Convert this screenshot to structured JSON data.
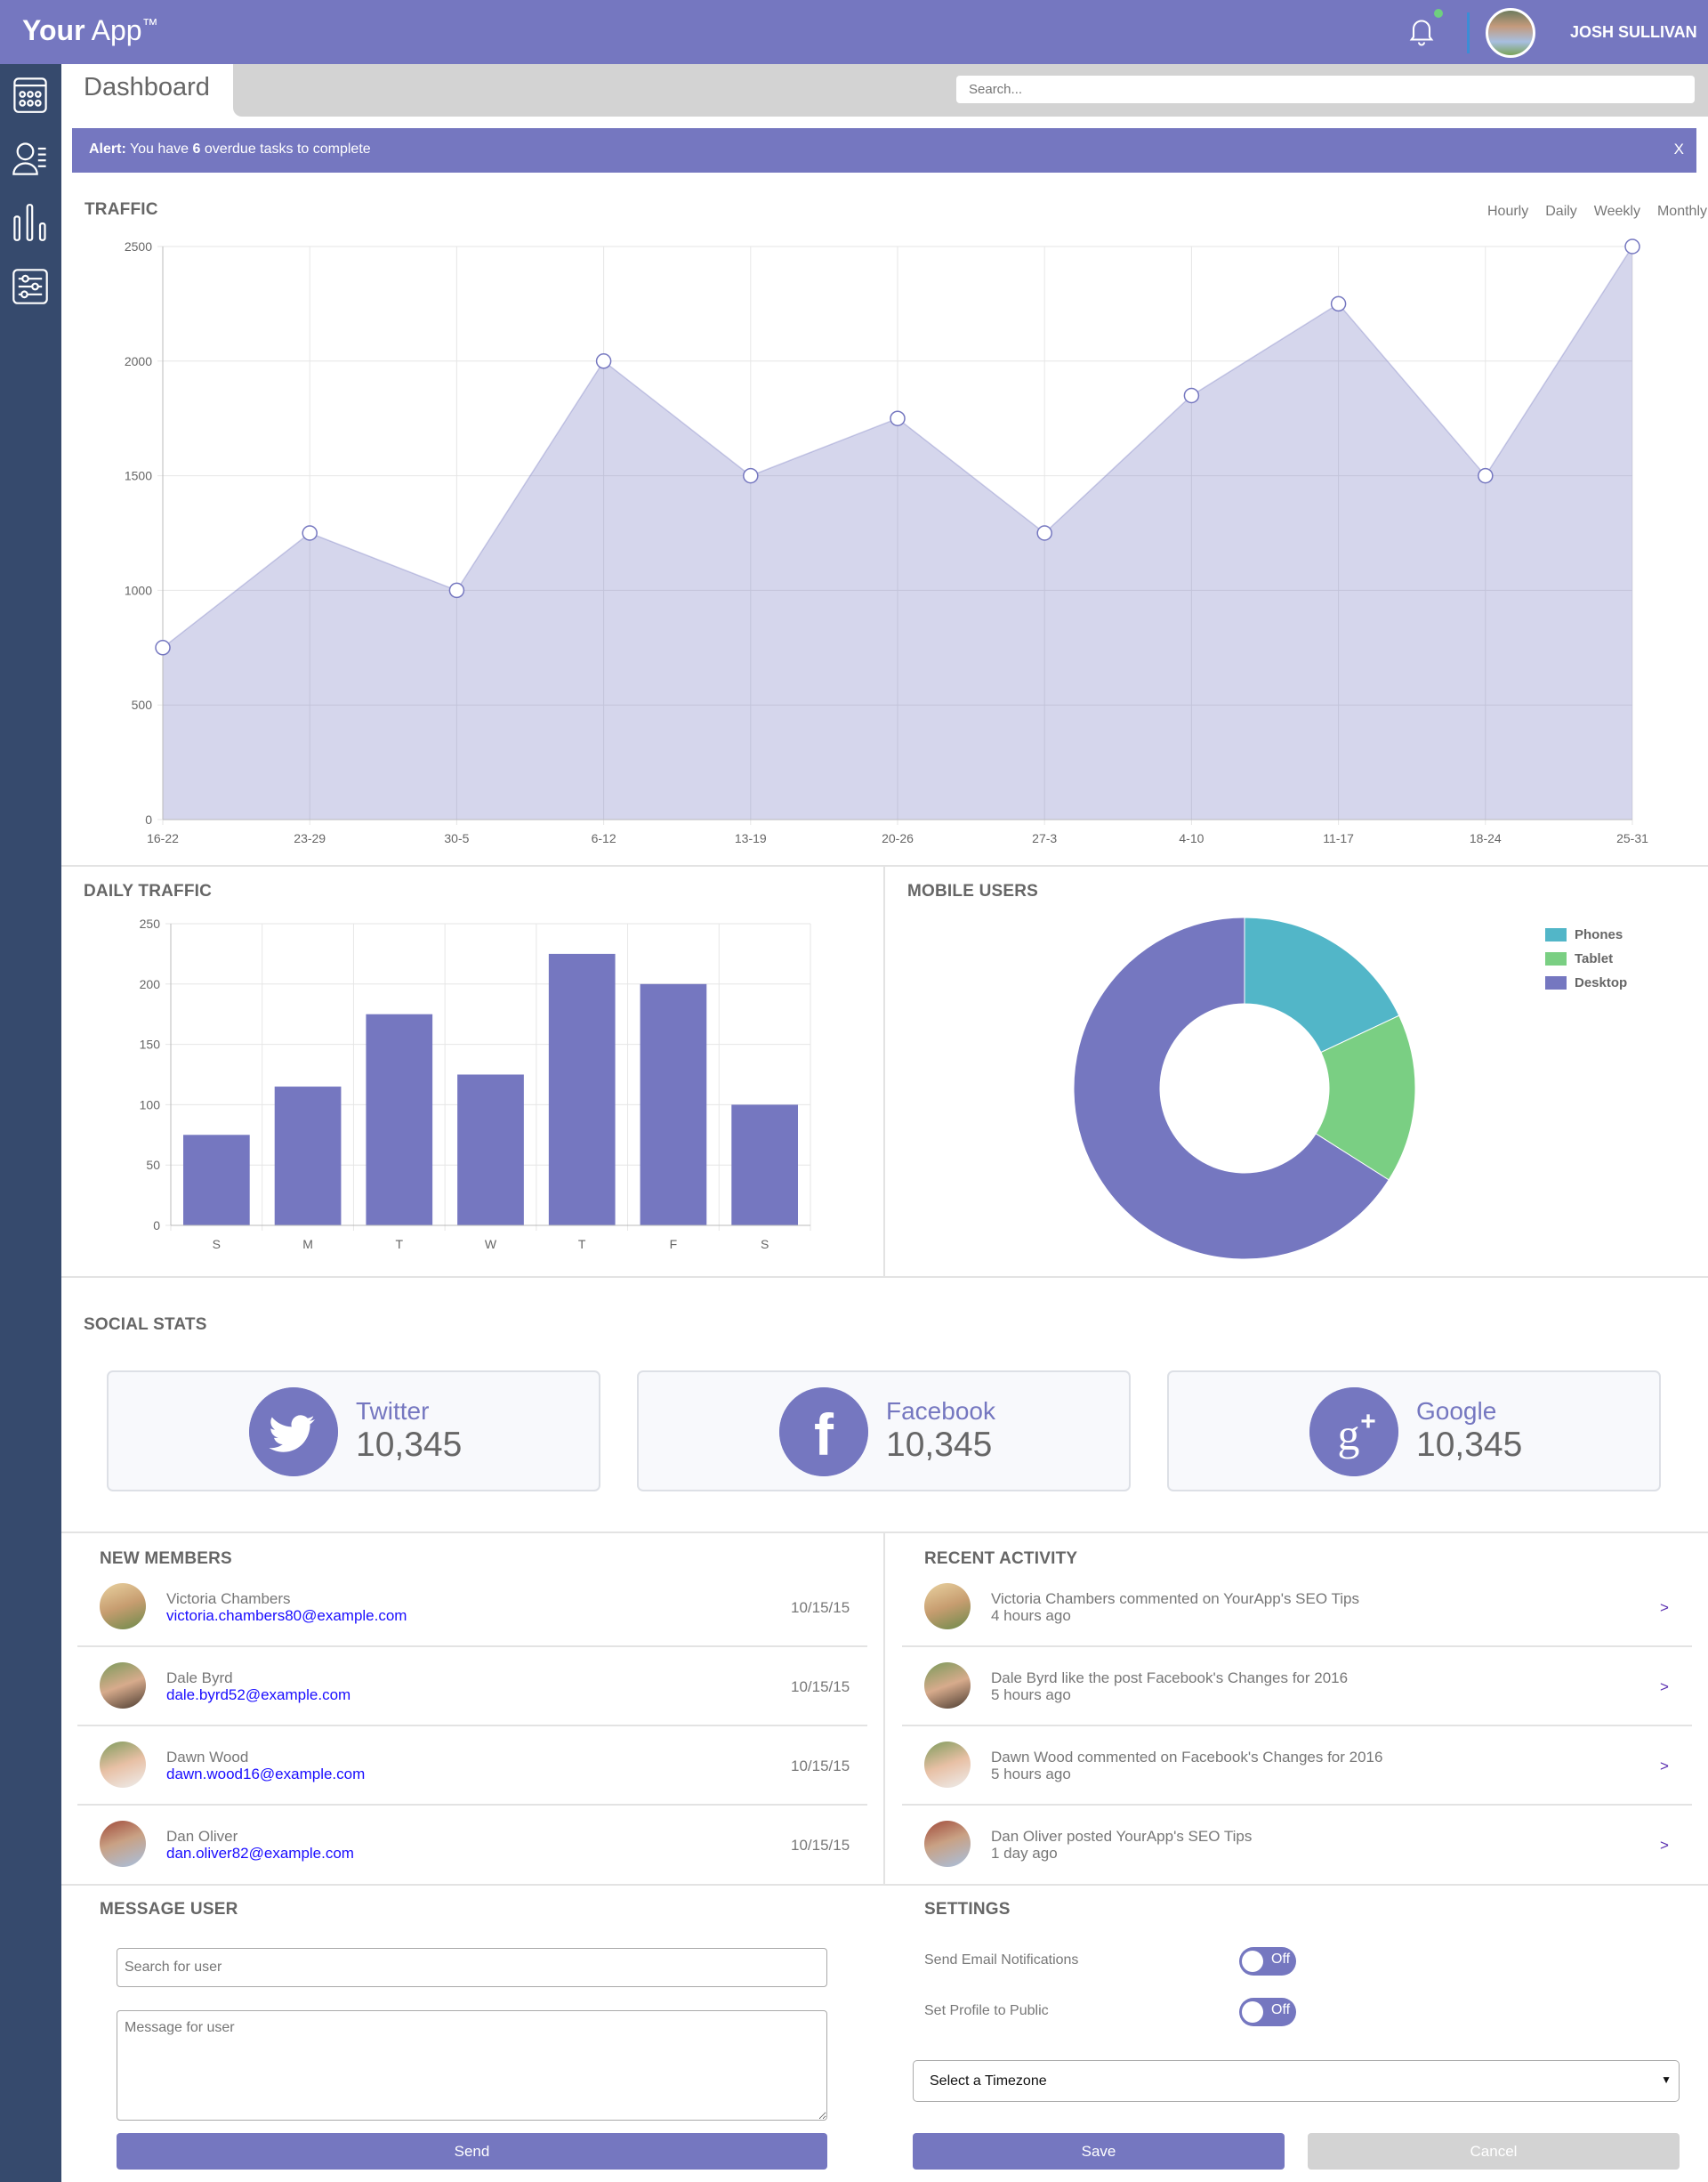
{
  "header": {
    "logo_bold": "Your",
    "logo_rest": "App",
    "logo_mark": "™",
    "user_name": "JOSH SULLIVAN",
    "bell_icon": "bell-icon",
    "notification_dot_color": "#6fcf7f"
  },
  "sidebar": {
    "items": [
      {
        "icon": "calendar-icon"
      },
      {
        "icon": "users-list-icon"
      },
      {
        "icon": "bar-chart-icon"
      },
      {
        "icon": "sliders-icon"
      }
    ]
  },
  "topbar": {
    "tab": "Dashboard",
    "search_placeholder": "Search..."
  },
  "alert": {
    "label": "Alert:",
    "pre": "You have",
    "count": "6",
    "post": "overdue tasks to complete",
    "close": "X"
  },
  "colors": {
    "accent": "#7577c0",
    "sidebar": "#364a6d",
    "phones": "#52b6c8",
    "tablet": "#7acf83",
    "desktop": "#7577c0"
  },
  "traffic": {
    "title": "TRAFFIC",
    "filters": [
      "Hourly",
      "Daily",
      "Weekly",
      "Monthly"
    ]
  },
  "daily": {
    "title": "DAILY TRAFFIC"
  },
  "mobile": {
    "title": "MOBILE USERS"
  },
  "chart_data": [
    {
      "type": "area",
      "categories": [
        "16-22",
        "23-29",
        "30-5",
        "6-12",
        "13-19",
        "20-26",
        "27-3",
        "4-10",
        "11-17",
        "18-24",
        "25-31"
      ],
      "values": [
        750,
        1250,
        1000,
        2000,
        1500,
        1750,
        1250,
        1850,
        2250,
        1500,
        2500
      ],
      "ylim": [
        0,
        2500
      ],
      "yticks": [
        0,
        500,
        1000,
        1500,
        2000,
        2500
      ],
      "grid": true
    },
    {
      "type": "bar",
      "categories": [
        "S",
        "M",
        "T",
        "W",
        "T",
        "F",
        "S"
      ],
      "values": [
        75,
        115,
        175,
        125,
        225,
        200,
        100
      ],
      "ylim": [
        0,
        250
      ],
      "yticks": [
        0,
        50,
        100,
        150,
        200,
        250
      ],
      "grid": true
    },
    {
      "type": "pie",
      "donut": true,
      "legend": "top-right",
      "labels": [
        "Phones",
        "Tablet",
        "Desktop"
      ],
      "values": [
        18,
        16,
        66
      ]
    }
  ],
  "social": {
    "title": "SOCIAL STATS",
    "cards": [
      {
        "label": "Twitter",
        "value": "10,345",
        "icon": "twitter-icon"
      },
      {
        "label": "Facebook",
        "value": "10,345",
        "icon": "facebook-icon"
      },
      {
        "label": "Google",
        "value": "10,345",
        "icon": "google-plus-icon"
      }
    ]
  },
  "members": {
    "title": "NEW MEMBERS",
    "rows": [
      {
        "name": "Victoria Chambers",
        "email": "victoria.chambers80@example.com",
        "date": "10/15/15"
      },
      {
        "name": "Dale Byrd",
        "email": "dale.byrd52@example.com",
        "date": "10/15/15"
      },
      {
        "name": "Dawn Wood",
        "email": "dawn.wood16@example.com",
        "date": "10/15/15"
      },
      {
        "name": "Dan Oliver",
        "email": "dan.oliver82@example.com",
        "date": "10/15/15"
      }
    ]
  },
  "activity": {
    "title": "RECENT ACTIVITY",
    "rows": [
      {
        "text": "Victoria Chambers commented on YourApp's SEO Tips",
        "time": "4 hours ago",
        "chevron": ">"
      },
      {
        "text": "Dale Byrd like the post Facebook's Changes for 2016",
        "time": "5 hours ago",
        "chevron": ">"
      },
      {
        "text": "Dawn Wood commented on Facebook's Changes for 2016",
        "time": "5 hours ago",
        "chevron": ">"
      },
      {
        "text": "Dan Oliver posted YourApp's SEO Tips",
        "time": "1 day ago",
        "chevron": ">"
      }
    ]
  },
  "message": {
    "title": "MESSAGE USER",
    "search_placeholder": "Search for user",
    "message_placeholder": "Message for user",
    "send": "Send"
  },
  "settings": {
    "title": "SETTINGS",
    "email_label": "Send Email Notifications",
    "email_state": "Off",
    "public_label": "Set Profile to Public",
    "public_state": "Off",
    "timezone": "Select a Timezone",
    "save": "Save",
    "cancel": "Cancel"
  }
}
